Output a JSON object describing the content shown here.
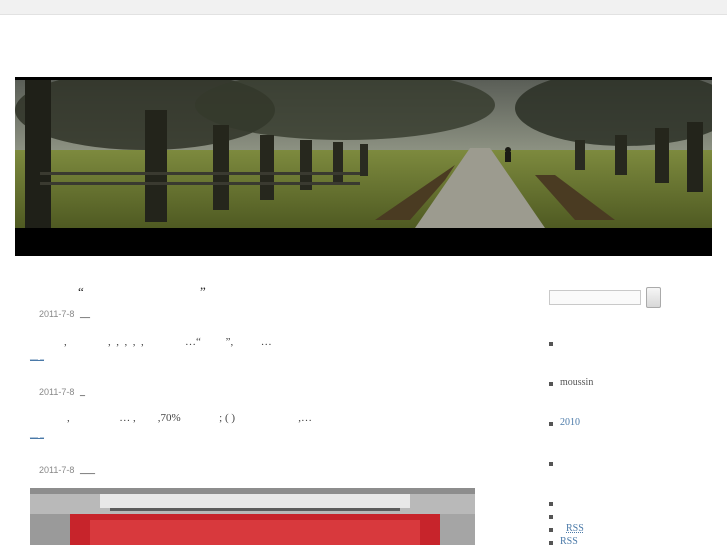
{
  "posts": [
    {
      "title_open_quote": "“",
      "title_close_quote": "”",
      "date": "2011-7-8",
      "author_link": "__",
      "excerpt": ",               ,  ,  ,  ,  ,               …“         ”,          …",
      "more_link": "__ _"
    },
    {
      "date": "2011-7-8",
      "author_link": "_",
      "excerpt": ",                  … ,        ,70%              ; ( )                       ,…",
      "more_link": "__ _"
    },
    {
      "date": "2011-7-8",
      "author_link": "___"
    }
  ],
  "sidebar": {
    "items": [
      {
        "text": ""
      },
      {
        "text": "moussin"
      },
      {
        "link": "2010"
      },
      {
        "text": ""
      },
      {
        "text": ""
      },
      {
        "text": ""
      },
      {
        "link": "RSS"
      },
      {
        "link": "RSS"
      }
    ]
  }
}
